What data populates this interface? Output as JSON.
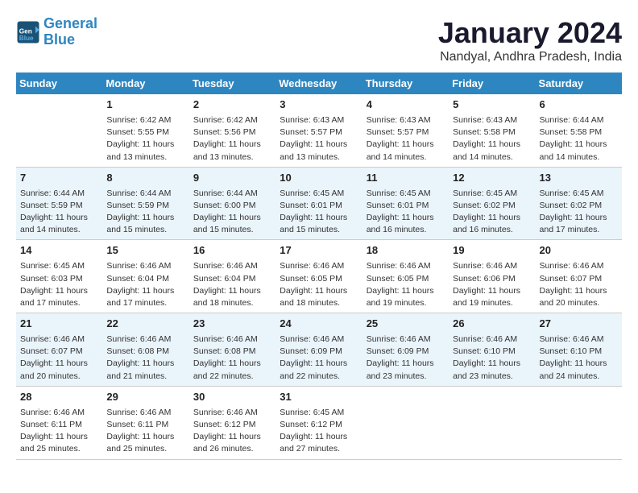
{
  "header": {
    "logo_line1": "General",
    "logo_line2": "Blue",
    "month_title": "January 2024",
    "location": "Nandyal, Andhra Pradesh, India"
  },
  "days_of_week": [
    "Sunday",
    "Monday",
    "Tuesday",
    "Wednesday",
    "Thursday",
    "Friday",
    "Saturday"
  ],
  "weeks": [
    [
      {
        "day": "",
        "info": ""
      },
      {
        "day": "1",
        "info": "Sunrise: 6:42 AM\nSunset: 5:55 PM\nDaylight: 11 hours\nand 13 minutes."
      },
      {
        "day": "2",
        "info": "Sunrise: 6:42 AM\nSunset: 5:56 PM\nDaylight: 11 hours\nand 13 minutes."
      },
      {
        "day": "3",
        "info": "Sunrise: 6:43 AM\nSunset: 5:57 PM\nDaylight: 11 hours\nand 13 minutes."
      },
      {
        "day": "4",
        "info": "Sunrise: 6:43 AM\nSunset: 5:57 PM\nDaylight: 11 hours\nand 14 minutes."
      },
      {
        "day": "5",
        "info": "Sunrise: 6:43 AM\nSunset: 5:58 PM\nDaylight: 11 hours\nand 14 minutes."
      },
      {
        "day": "6",
        "info": "Sunrise: 6:44 AM\nSunset: 5:58 PM\nDaylight: 11 hours\nand 14 minutes."
      }
    ],
    [
      {
        "day": "7",
        "info": "Sunrise: 6:44 AM\nSunset: 5:59 PM\nDaylight: 11 hours\nand 14 minutes."
      },
      {
        "day": "8",
        "info": "Sunrise: 6:44 AM\nSunset: 5:59 PM\nDaylight: 11 hours\nand 15 minutes."
      },
      {
        "day": "9",
        "info": "Sunrise: 6:44 AM\nSunset: 6:00 PM\nDaylight: 11 hours\nand 15 minutes."
      },
      {
        "day": "10",
        "info": "Sunrise: 6:45 AM\nSunset: 6:01 PM\nDaylight: 11 hours\nand 15 minutes."
      },
      {
        "day": "11",
        "info": "Sunrise: 6:45 AM\nSunset: 6:01 PM\nDaylight: 11 hours\nand 16 minutes."
      },
      {
        "day": "12",
        "info": "Sunrise: 6:45 AM\nSunset: 6:02 PM\nDaylight: 11 hours\nand 16 minutes."
      },
      {
        "day": "13",
        "info": "Sunrise: 6:45 AM\nSunset: 6:02 PM\nDaylight: 11 hours\nand 17 minutes."
      }
    ],
    [
      {
        "day": "14",
        "info": "Sunrise: 6:45 AM\nSunset: 6:03 PM\nDaylight: 11 hours\nand 17 minutes."
      },
      {
        "day": "15",
        "info": "Sunrise: 6:46 AM\nSunset: 6:04 PM\nDaylight: 11 hours\nand 17 minutes."
      },
      {
        "day": "16",
        "info": "Sunrise: 6:46 AM\nSunset: 6:04 PM\nDaylight: 11 hours\nand 18 minutes."
      },
      {
        "day": "17",
        "info": "Sunrise: 6:46 AM\nSunset: 6:05 PM\nDaylight: 11 hours\nand 18 minutes."
      },
      {
        "day": "18",
        "info": "Sunrise: 6:46 AM\nSunset: 6:05 PM\nDaylight: 11 hours\nand 19 minutes."
      },
      {
        "day": "19",
        "info": "Sunrise: 6:46 AM\nSunset: 6:06 PM\nDaylight: 11 hours\nand 19 minutes."
      },
      {
        "day": "20",
        "info": "Sunrise: 6:46 AM\nSunset: 6:07 PM\nDaylight: 11 hours\nand 20 minutes."
      }
    ],
    [
      {
        "day": "21",
        "info": "Sunrise: 6:46 AM\nSunset: 6:07 PM\nDaylight: 11 hours\nand 20 minutes."
      },
      {
        "day": "22",
        "info": "Sunrise: 6:46 AM\nSunset: 6:08 PM\nDaylight: 11 hours\nand 21 minutes."
      },
      {
        "day": "23",
        "info": "Sunrise: 6:46 AM\nSunset: 6:08 PM\nDaylight: 11 hours\nand 22 minutes."
      },
      {
        "day": "24",
        "info": "Sunrise: 6:46 AM\nSunset: 6:09 PM\nDaylight: 11 hours\nand 22 minutes."
      },
      {
        "day": "25",
        "info": "Sunrise: 6:46 AM\nSunset: 6:09 PM\nDaylight: 11 hours\nand 23 minutes."
      },
      {
        "day": "26",
        "info": "Sunrise: 6:46 AM\nSunset: 6:10 PM\nDaylight: 11 hours\nand 23 minutes."
      },
      {
        "day": "27",
        "info": "Sunrise: 6:46 AM\nSunset: 6:10 PM\nDaylight: 11 hours\nand 24 minutes."
      }
    ],
    [
      {
        "day": "28",
        "info": "Sunrise: 6:46 AM\nSunset: 6:11 PM\nDaylight: 11 hours\nand 25 minutes."
      },
      {
        "day": "29",
        "info": "Sunrise: 6:46 AM\nSunset: 6:11 PM\nDaylight: 11 hours\nand 25 minutes."
      },
      {
        "day": "30",
        "info": "Sunrise: 6:46 AM\nSunset: 6:12 PM\nDaylight: 11 hours\nand 26 minutes."
      },
      {
        "day": "31",
        "info": "Sunrise: 6:45 AM\nSunset: 6:12 PM\nDaylight: 11 hours\nand 27 minutes."
      },
      {
        "day": "",
        "info": ""
      },
      {
        "day": "",
        "info": ""
      },
      {
        "day": "",
        "info": ""
      }
    ]
  ]
}
